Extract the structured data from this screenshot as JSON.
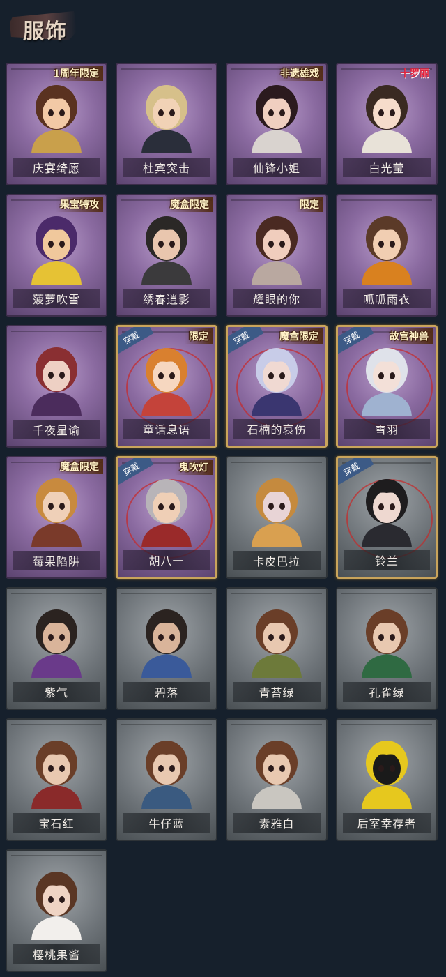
{
  "header": {
    "title": "服饰"
  },
  "costumes": [
    {
      "name": "庆宴绮愿",
      "style": "purple",
      "badge": "1周年限定",
      "wearing": false,
      "hair": "#5a3220",
      "skin": "#f2c9a6",
      "outfit": "#c9a04b"
    },
    {
      "name": "杜宾突击",
      "style": "purple",
      "badge": "",
      "wearing": false,
      "hair": "#d6c08a",
      "skin": "#f1d2b6",
      "outfit": "#2a2e3a"
    },
    {
      "name": "仙锋小姐",
      "style": "purple",
      "badge": "非遗雄戏",
      "wearing": false,
      "hair": "#2b1a1e",
      "skin": "#f0cfc0",
      "outfit": "#d9d3cf"
    },
    {
      "name": "白光莹",
      "style": "purple",
      "badge": "十罗丽",
      "badgeStyle": "pink",
      "wearing": false,
      "hair": "#3a2a22",
      "skin": "#f6dccb",
      "outfit": "#e8e2d8"
    },
    {
      "name": "菠萝吹雪",
      "style": "purple",
      "badge": "果宝特攻",
      "wearing": false,
      "hair": "#4b2a6a",
      "skin": "#f0c89c",
      "outfit": "#e6c234"
    },
    {
      "name": "绣春逍影",
      "style": "purple",
      "badge": "魔盒限定",
      "wearing": false,
      "hair": "#2b2826",
      "skin": "#e9c6ae",
      "outfit": "#3b3a3c"
    },
    {
      "name": "耀眼的你",
      "style": "purple",
      "badge": "限定",
      "wearing": false,
      "hair": "#4a2a22",
      "skin": "#f0cdbd",
      "outfit": "#b9a8a0"
    },
    {
      "name": "呱呱雨衣",
      "style": "purple",
      "badge": "",
      "wearing": false,
      "hair": "#5b3a28",
      "skin": "#f1ceb2",
      "outfit": "#d9811f"
    },
    {
      "name": "千夜星谕",
      "style": "purple",
      "badge": "",
      "wearing": false,
      "hair": "#8a2f32",
      "skin": "#eed0c4",
      "outfit": "#4b2c5c"
    },
    {
      "name": "童话息语",
      "style": "purple",
      "badge": "限定",
      "wearing": true,
      "hair": "#d9802f",
      "skin": "#f6d7c0",
      "outfit": "#c4433a"
    },
    {
      "name": "石楠的哀伤",
      "style": "purple",
      "badge": "魔盒限定",
      "wearing": true,
      "hair": "#c8cce8",
      "skin": "#f0d9d2",
      "outfit": "#3a3670"
    },
    {
      "name": "雪羽",
      "style": "purple",
      "badge": "故宫神兽",
      "wearing": true,
      "hair": "#dfe2ea",
      "skin": "#f3e0d8",
      "outfit": "#9fb2d0"
    },
    {
      "name": "莓果陷阱",
      "style": "purple",
      "badge": "魔盒限定",
      "wearing": false,
      "hair": "#c88a3e",
      "skin": "#efd0b8",
      "outfit": "#7a3a2a"
    },
    {
      "name": "胡八一",
      "style": "purple",
      "badge": "鬼吹灯",
      "wearing": true,
      "hair": "#b8b4b8",
      "skin": "#efcfb6",
      "outfit": "#9a2a2a"
    },
    {
      "name": "卡皮巴拉",
      "style": "gray",
      "badge": "",
      "wearing": false,
      "hair": "#c58a3e",
      "skin": "#e8d4d6",
      "outfit": "#d9a050"
    },
    {
      "name": "铃兰",
      "style": "gray",
      "badge": "",
      "wearing": true,
      "hair": "#1e1c1e",
      "skin": "#eed8d0",
      "outfit": "#2a2a30"
    },
    {
      "name": "紫气",
      "style": "gray",
      "badge": "",
      "wearing": false,
      "hair": "#2b2320",
      "skin": "#d9b49a",
      "outfit": "#6a3a8a"
    },
    {
      "name": "碧落",
      "style": "gray",
      "badge": "",
      "wearing": false,
      "hair": "#2b2320",
      "skin": "#d9b49a",
      "outfit": "#3a5a9a"
    },
    {
      "name": "青苔绿",
      "style": "gray",
      "badge": "",
      "wearing": false,
      "hair": "#6a3e28",
      "skin": "#e8c8b0",
      "outfit": "#6d7a3a"
    },
    {
      "name": "孔雀绿",
      "style": "gray",
      "badge": "",
      "wearing": false,
      "hair": "#6a3e28",
      "skin": "#e8c8b0",
      "outfit": "#2f6a42"
    },
    {
      "name": "宝石红",
      "style": "gray",
      "badge": "",
      "wearing": false,
      "hair": "#6a3e28",
      "skin": "#e8c8b0",
      "outfit": "#8a2a2a"
    },
    {
      "name": "牛仔蓝",
      "style": "gray",
      "badge": "",
      "wearing": false,
      "hair": "#6a3e28",
      "skin": "#e8c8b0",
      "outfit": "#3a5a80"
    },
    {
      "name": "素雅白",
      "style": "gray",
      "badge": "",
      "wearing": false,
      "hair": "#6a3e28",
      "skin": "#e8c8b0",
      "outfit": "#c9c6c0"
    },
    {
      "name": "后室幸存者",
      "style": "gray",
      "badge": "",
      "wearing": false,
      "hair": "#e6c81e",
      "skin": "#1a1a1a",
      "outfit": "#e6c81e"
    },
    {
      "name": "樱桃果酱",
      "style": "gray",
      "badge": "",
      "wearing": false,
      "hair": "#5a3624",
      "skin": "#efd4c4",
      "outfit": "#f2efec"
    }
  ],
  "wear_label": "穿戴"
}
